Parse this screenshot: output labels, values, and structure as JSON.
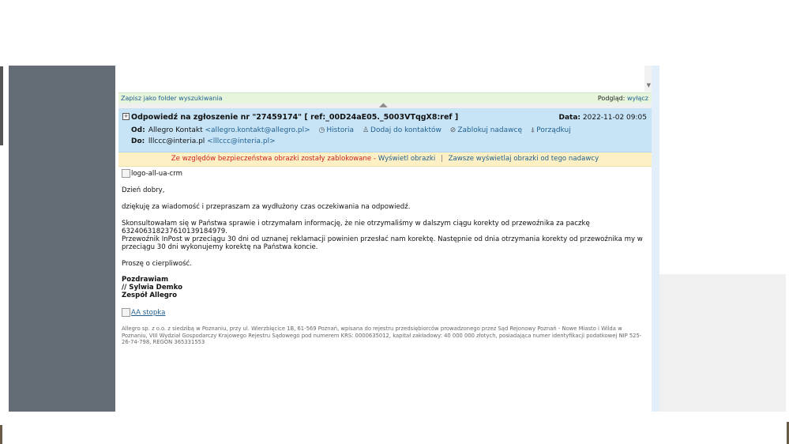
{
  "search_bar": {
    "save_folder_label": "Zapisz jako folder wyszukiwania",
    "preview_label": "Podgląd:",
    "preview_off_label": "wyłącz"
  },
  "message": {
    "subject": "Odpowiedź na zgłoszenie nr \"27459174\" [ ref:_00D24aE05._5003VTqgX8:ref ]",
    "date_label": "Data:",
    "date_value": "2022-11-02 09:05",
    "from_label": "Od:",
    "from_name": "Allegro Kontakt",
    "from_email": "<allegro.kontakt@allegro.pl>",
    "to_label": "Do:",
    "to_name": "lllccc@interia.pl",
    "to_email": "<lllccc@interia.pl>",
    "actions": {
      "history": "Historia",
      "add_contact": "Dodaj do kontaktów",
      "block_sender": "Zablokuj nadawcę",
      "organize": "Porządkuj"
    }
  },
  "warning": {
    "text": "Ze względów bezpieczeństwa obrazki zostały zablokowane -",
    "show_images": "Wyświetl obrazki",
    "separator": "|",
    "always_show": "Zawsze wyświetlaj obrazki od tego nadawcy"
  },
  "body": {
    "logo_alt": "logo-all-ua-crm",
    "greeting": "Dzień dobry,",
    "p1": "dziękuję za wiadomość i przepraszam za wydłużony czas oczekiwania na odpowiedź.",
    "p2": "Skonsultowałam się w Państwa sprawie i otrzymałam informację, że nie otrzymaliśmy w dalszym ciągu korekty od przewoźnika za paczkę 632406318237610139184979.",
    "p3": "Przewoźnik InPost w przeciągu 30 dni od uznanej reklamacji powinien przesłać nam korektę. Następnie od dnia otrzymania korekty od przewoźnika my w przeciągu 30 dni wykonujemy korektę na Państwa koncie.",
    "p4": "Proszę o cierpliwość.",
    "sign1": "Pozdrawiam",
    "sign2": "// Sylwia Demko",
    "sign3": "Zespół Allegro",
    "footer_img_alt": "AA stopka",
    "footer_legal": "Allegro sp. z o.o. z siedzibą w Poznaniu, przy ul. Wierzbięcice 1B, 61-569 Poznań, wpisana do rejestru przedsiębiorców prowadzonego przez Sąd Rejonowy Poznań - Nowe Miasto i Wilda w Poznaniu, VIII Wydział Gospodarczy Krajowego Rejestru Sądowego pod numerem KRS: 0000635012, kapitał zakładowy: 40 000 000 złotych, posiadająca numer identyfikacji podatkowej NIP 525-26-74-798, REGON 365331553"
  },
  "icons": {
    "history": "clock-icon",
    "add_contact": "user-add-icon",
    "block_sender": "block-icon",
    "organize": "broom-icon",
    "toggle": "expand-icon",
    "scroll": "chevron-down-icon",
    "splitter": "resize-grip-icon"
  },
  "colors": {
    "header_bg": "#c7e4f7",
    "warning_bg": "#fcf0c4",
    "warning_text": "#cc1f1f",
    "link": "#1f5f8f",
    "search_bar_bg": "#e6f5dc",
    "left_panel": "#646d75"
  }
}
